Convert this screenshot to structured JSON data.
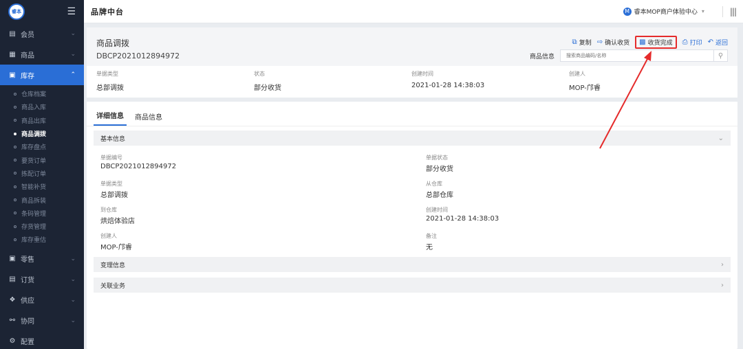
{
  "sidebar": {
    "logo_text": "睿本",
    "groups_top": [
      {
        "label": "会员",
        "icon": "member-card-icon"
      },
      {
        "label": "商品",
        "icon": "grid-icon"
      }
    ],
    "active_group": {
      "label": "库存",
      "icon": "warehouse-icon"
    },
    "subitems": [
      {
        "label": "仓库档案"
      },
      {
        "label": "商品入库"
      },
      {
        "label": "商品出库"
      },
      {
        "label": "商品调拨"
      },
      {
        "label": "库存盘点"
      },
      {
        "label": "要货订单"
      },
      {
        "label": "拣配订单"
      },
      {
        "label": "智能补货"
      },
      {
        "label": "商品拆装"
      },
      {
        "label": "条码管理"
      },
      {
        "label": "存货管理"
      },
      {
        "label": "库存重估"
      }
    ],
    "groups_bottom": [
      {
        "label": "零售",
        "icon": "shop-icon"
      },
      {
        "label": "订货",
        "icon": "order-icon"
      },
      {
        "label": "供应",
        "icon": "supply-icon"
      },
      {
        "label": "协同",
        "icon": "share-icon"
      },
      {
        "label": "配置",
        "icon": "gear-icon"
      }
    ]
  },
  "topbar": {
    "brand": "品牌中台",
    "avatar_letter": "M",
    "user_name": "睿本MOP商户体验中心"
  },
  "header": {
    "title": "商品调拨",
    "doc_no": "DBCP2021012894972",
    "actions": {
      "copy": "复制",
      "confirm": "确认收货",
      "complete": "收货完成",
      "print": "打印",
      "back": "返回"
    },
    "search_label": "商品信息",
    "search_placeholder": "搜索商品编码/名称"
  },
  "summary": {
    "type_label": "单据类型",
    "type_value": "总部调拨",
    "status_label": "状态",
    "status_value": "部分收货",
    "created_label": "创建时间",
    "created_value": "2021-01-28 14:38:03",
    "creator_label": "创建人",
    "creator_value": "MOP-邝睿"
  },
  "tabs": {
    "detail": "详细信息",
    "goods": "商品信息"
  },
  "basic": {
    "title": "基本信息",
    "doc_no_label": "单据编号",
    "doc_no_value": "DBCP2021012894972",
    "status_label": "单据状态",
    "status_value": "部分收货",
    "type_label": "单据类型",
    "type_value": "总部调拨",
    "from_label": "从仓库",
    "from_value": "总部仓库",
    "to_label": "到仓库",
    "to_value": "烘焙体验店",
    "time_label": "创建时间",
    "time_value": "2021-01-28 14:38:03",
    "creator_label": "创建人",
    "creator_value": "MOP-邝睿",
    "remark_label": "备注",
    "remark_value": "无"
  },
  "sections": {
    "change": "变理信息",
    "related": "关联业务"
  },
  "colors": {
    "accent": "#2a6ed6",
    "sidebar": "#1c2434",
    "highlight": "#e52b2b"
  }
}
